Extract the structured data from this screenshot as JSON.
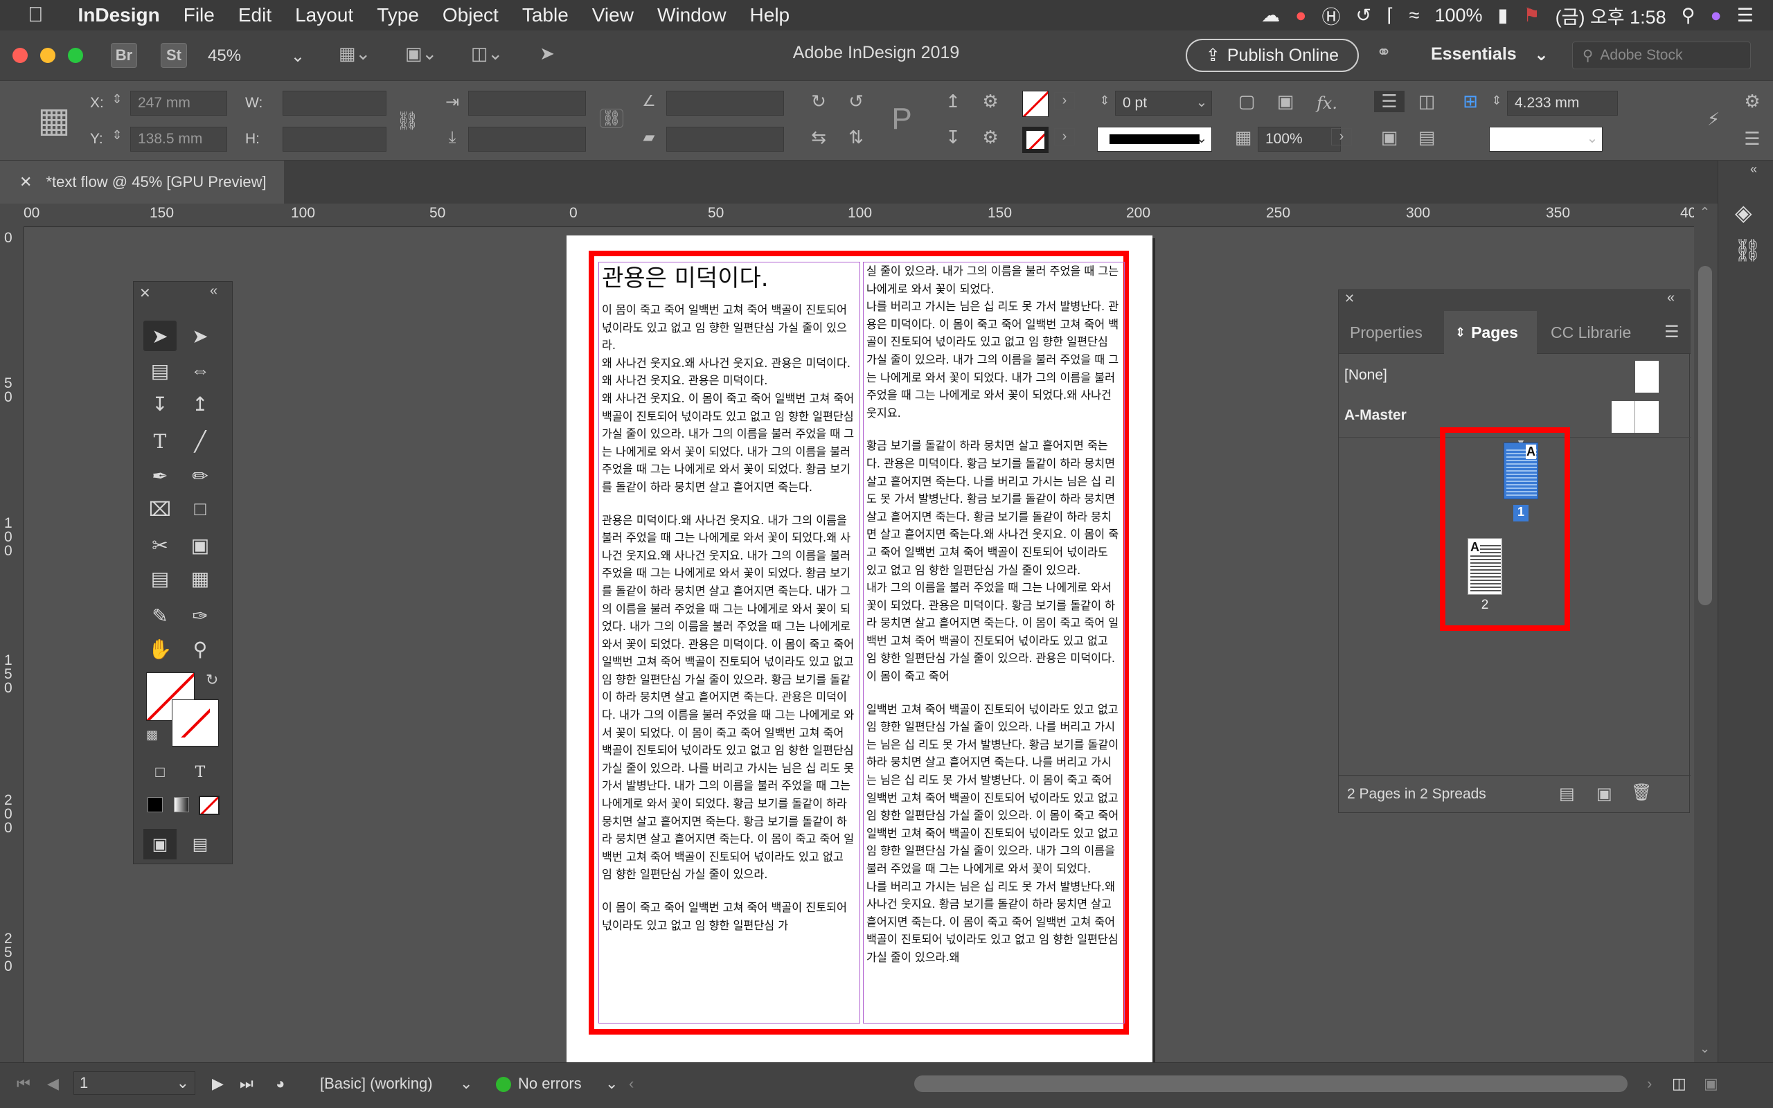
{
  "menubar": {
    "app_name": "InDesign",
    "items": [
      "File",
      "Edit",
      "Layout",
      "Type",
      "Object",
      "Table",
      "View",
      "Window",
      "Help"
    ],
    "battery": "100%",
    "clock": "(금) 오후 1:58"
  },
  "appbar": {
    "bridge_label": "Br",
    "stock_label": "St",
    "zoom": "45%",
    "title": "Adobe InDesign 2019",
    "publish_label": "Publish Online",
    "workspace": "Essentials",
    "stock_placeholder": "Adobe Stock"
  },
  "control": {
    "x_label": "X:",
    "y_label": "Y:",
    "w_label": "W:",
    "h_label": "H:",
    "x_value": "247 mm",
    "y_value": "138.5 mm",
    "stroke_weight": "0 pt",
    "opacity": "100%",
    "gutter": "4.233 mm",
    "fx_label": "fx."
  },
  "document": {
    "tab_title": "*text flow @ 45% [GPU Preview]"
  },
  "ruler": {
    "h_labels": [
      "00",
      "150",
      "100",
      "50",
      "0",
      "50",
      "100",
      "150",
      "200",
      "250",
      "300",
      "350",
      "40"
    ],
    "v_labels": [
      "0",
      "5\n0",
      "1\n0\n0",
      "1\n5\n0",
      "2\n0\n0",
      "2\n5\n0"
    ]
  },
  "page_text": {
    "headline": "관용은 미덕이다.",
    "left_paragraphs": [
      " 이 몸이 죽고 죽어 일백번 고쳐 죽어 백골이 진토되어 넋이라도 있고 없고 임 향한 일편단심 가실 줄이 있으라.",
      "왜 사나건 웃지요.왜 사나건 웃지요. 관용은 미덕이다.왜 사나건 웃지요. 관용은 미덕이다.",
      "왜 사나건 웃지요. 이 몸이 죽고 죽어 일백번 고쳐 죽어 백골이 진토되어 넋이라도 있고 없고 임 향한 일편단심 가실 줄이 있으라. 내가 그의 이름을 불러 주었을 때 그는 나에게로 와서 꽃이 되었다. 내가 그의 이름을 불러 주었을 때 그는 나에게로 와서 꽃이 되었다. 황금 보기를 돌같이 하라 뭉치면 살고 흩어지면 죽는다.",
      "",
      " 관용은 미덕이다.왜 사나건 웃지요. 내가 그의 이름을 불러 주었을 때 그는 나에게로 와서 꽃이 되었다.왜 사나건 웃지요.왜 사나건 웃지요. 내가 그의 이름을 불러 주었을 때 그는 나에게로 와서 꽃이 되었다. 황금 보기를 돌같이 하라 뭉치면 살고 흩어지면 죽는다. 내가 그의 이름을 불러 주었을 때 그는 나에게로 와서 꽃이 되었다. 내가 그의 이름을 불러 주었을 때 그는 나에게로 와서 꽃이 되었다. 관용은 미덕이다. 이 몸이 죽고 죽어 일백번 고쳐 죽어 백골이 진토되어 넋이라도 있고 없고 임 향한 일편단심 가실 줄이 있으라. 황금 보기를 돌같이 하라 뭉치면 살고 흩어지면 죽는다. 관용은 미덕이다. 내가 그의 이름을 불러 주었을 때 그는 나에게로 와서 꽃이 되었다. 이 몸이 죽고 죽어 일백번 고쳐 죽어 백골이 진토되어 넋이라도 있고 없고 임 향한 일편단심 가실 줄이 있으라. 나를 버리고 가시는 님은 십 리도 못 가서 발병난다. 내가 그의 이름을 불러 주었을 때 그는 나에게로 와서 꽃이 되었다. 황금 보기를 돌같이 하라 뭉치면 살고 흩어지면 죽는다. 황금 보기를 돌같이 하라 뭉치면 살고 흩어지면 죽는다. 이 몸이 죽고 죽어 일백번 고쳐 죽어 백골이 진토되어 넋이라도 있고 없고 임 향한 일편단심 가실 줄이 있으라.",
      "",
      " 이 몸이 죽고 죽어 일백번 고쳐 죽어 백골이 진토되어 넋이라도 있고 없고 임 향한 일편단심 가"
    ],
    "right_paragraphs": [
      "실 줄이 있으라. 내가 그의 이름을 불러 주었을 때 그는 나에게로 와서 꽃이 되었다.",
      " 나를 버리고 가시는 님은 십 리도 못 가서 발병난다. 관용은 미덕이다. 이 몸이 죽고 죽어 일백번 고쳐 죽어 백골이 진토되어 넋이라도 있고 없고 임 향한 일편단심 가실 줄이 있으라. 내가 그의 이름을 불러 주었을 때 그는 나에게로 와서 꽃이 되었다. 내가 그의 이름을 불러 주었을 때 그는 나에게로 와서 꽃이 되었다.왜 사나건 웃지요.",
      "",
      "황금 보기를 돌같이 하라 뭉치면 살고 흩어지면 죽는다. 관용은 미덕이다. 황금 보기를 돌같이 하라 뭉치면 살고 흩어지면 죽는다. 나를 버리고 가시는 님은 십 리도 못 가서 발병난다. 황금 보기를 돌같이 하라 뭉치면 살고 흩어지면 죽는다. 황금 보기를 돌같이 하라 뭉치면 살고 흩어지면 죽는다.왜 사나건 웃지요. 이 몸이 죽고 죽어 일백번 고쳐 죽어 백골이 진토되어 넋이라도 있고 없고 임 향한 일편단심 가실 줄이 있으라.",
      " 내가 그의 이름을 불러 주었을 때 그는 나에게로 와서 꽃이 되었다. 관용은 미덕이다. 황금 보기를 돌같이 하라 뭉치면 살고 흩어지면 죽는다. 이 몸이 죽고 죽어 일백번 고쳐 죽어 백골이 진토되어 넋이라도 있고 없고 임 향한 일편단심 가실 줄이 있으라. 관용은 미덕이다. 이 몸이 죽고 죽어",
      "",
      "일백번 고쳐 죽어 백골이 진토되어 넋이라도 있고 없고 임 향한 일편단심 가실 줄이 있으라. 나를 버리고 가시는 님은 십 리도 못 가서 발병난다. 황금 보기를 돌같이 하라 뭉치면 살고 흩어지면 죽는다. 나를 버리고 가시는 님은 십 리도 못 가서 발병난다. 이 몸이 죽고 죽어 일백번 고쳐 죽어 백골이 진토되어 넋이라도 있고 없고 임 향한 일편단심 가실 줄이 있으라. 이 몸이 죽고 죽어 일백번 고쳐 죽어 백골이 진토되어 넋이라도 있고 없고 임 향한 일편단심 가실 줄이 있으라. 내가 그의 이름을 불러 주었을 때 그는 나에게로 와서 꽃이 되었다.",
      " 나를 버리고 가시는 님은 십 리도 못 가서 발병난다.왜 사나건 웃지요. 황금 보기를 돌같이 하라 뭉치면 살고 흩어지면 죽는다. 이 몸이 죽고 죽어 일백번 고쳐 죽어 백골이 진토되어 넋이라도 있고 없고 임 향한 일편단심 가실 줄이 있으라.왜"
    ]
  },
  "pages_panel": {
    "tabs": [
      "Properties",
      "Pages",
      "CC Librarie"
    ],
    "none_label": "[None]",
    "master_label": "A-Master",
    "page1_number": "1",
    "page2_number": "2",
    "master_letter": "A",
    "summary": "2 Pages in 2 Spreads"
  },
  "tools": {
    "type_tool_glyph": "T",
    "format_text_glyph": "T"
  },
  "status": {
    "page_number": "1",
    "style": "[Basic] (working)",
    "errors": "No errors",
    "ok_color": "#2eb82e"
  },
  "colors": {
    "highlight_red": "#ff0000",
    "frame_purple": "#b060d0",
    "page_thumb_blue": "#3a7bd5"
  }
}
